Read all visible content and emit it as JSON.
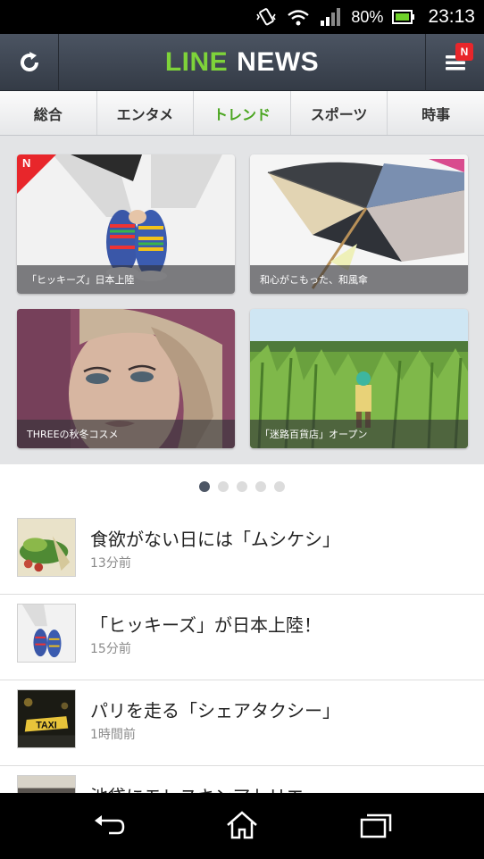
{
  "status_bar": {
    "battery_percent": "80%",
    "time": "23:13",
    "icons": [
      "vibrate-icon",
      "wifi-icon",
      "signal-icon",
      "battery-icon"
    ]
  },
  "header": {
    "title_part1": "LINE",
    "title_part2": "NEWS",
    "menu_badge": "N",
    "brand_color": "#7ed33a"
  },
  "tabs": [
    {
      "label": "総合"
    },
    {
      "label": "エンタメ"
    },
    {
      "label": "トレンド"
    },
    {
      "label": "スポーツ"
    },
    {
      "label": "時事"
    }
  ],
  "featured": [
    {
      "caption": "「ヒッキーズ」日本上陸",
      "badge": "N"
    },
    {
      "caption": "和心がこもった、和風傘"
    },
    {
      "caption": "THREEの秋冬コスメ"
    },
    {
      "caption": "「迷路百貨店」オープン"
    }
  ],
  "pager": {
    "total": 5,
    "active": 1
  },
  "articles": [
    {
      "headline": "食欲がない日には「ムシケシ」",
      "time": "13分前"
    },
    {
      "headline": "「ヒッキーズ」が日本上陸！",
      "time": "15分前"
    },
    {
      "headline": "パリを走る「シェアタクシー」",
      "time": "1時間前"
    },
    {
      "headline": "池袋にモレスキンアトリエ",
      "time": ""
    }
  ],
  "thumb_text": {
    "taxi_sign": "TAXI"
  }
}
